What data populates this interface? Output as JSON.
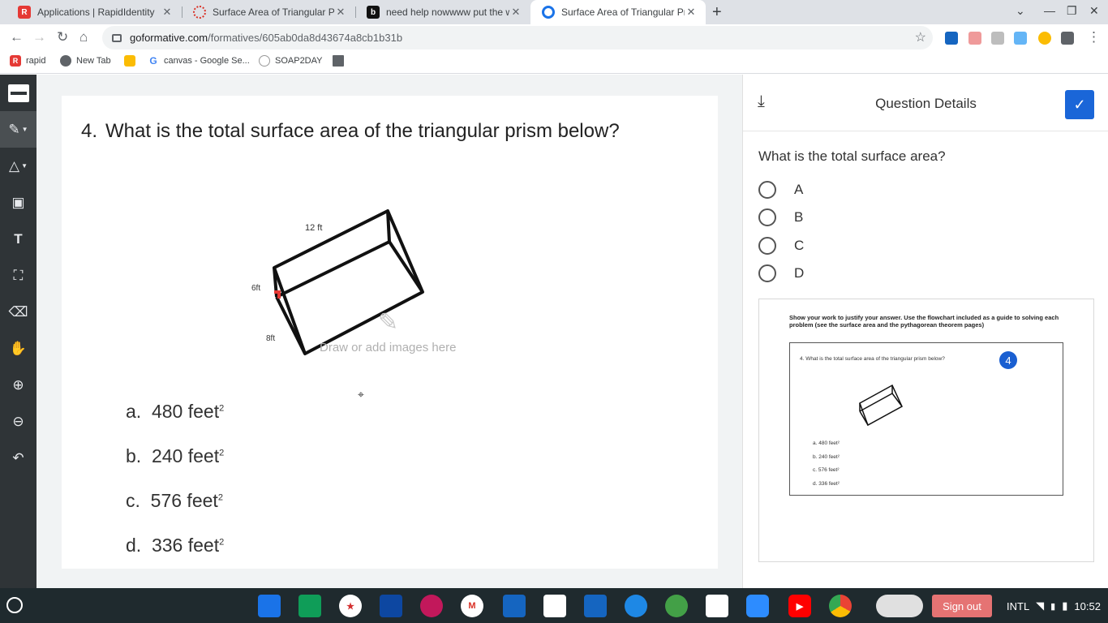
{
  "browser": {
    "tabs": [
      {
        "title": "Applications | RapidIdentity",
        "active": false
      },
      {
        "title": "Surface Area of Triangular Prism",
        "active": false
      },
      {
        "title": "need help nowwww put the work",
        "active": false
      },
      {
        "title": "Surface Area of Triangular Prism",
        "active": true
      }
    ],
    "url_host": "goformative.com",
    "url_path": "/formatives/605ab0da8d43674a8cb1b31b",
    "bookmarks": [
      "rapid",
      "New Tab",
      "canvas - Google Se...",
      "SOAP2DAY"
    ]
  },
  "tools": [
    "pen",
    "shapes",
    "image",
    "text",
    "expand",
    "eraser",
    "pan",
    "zoom-in",
    "zoom-out",
    "undo"
  ],
  "question": {
    "number": "4.",
    "text": "What is the total surface area of the triangular prism below?",
    "figure_labels": {
      "length": "12 ft",
      "height": "6ft",
      "base": "8ft"
    },
    "options": [
      {
        "letter": "a.",
        "value": "480 feet",
        "exp": "2"
      },
      {
        "letter": "b.",
        "value": "240 feet",
        "exp": "2"
      },
      {
        "letter": "c.",
        "value": "576 feet",
        "exp": "2"
      },
      {
        "letter": "d.",
        "value": "336 feet",
        "exp": "2"
      }
    ],
    "draw_hint": "Draw or add images here"
  },
  "panel": {
    "title": "Question Details",
    "prompt": "What is the total surface area?",
    "choices": [
      "A",
      "B",
      "C",
      "D"
    ],
    "preview_instructions": "Show your work to justify your answer.  Use the flowchart included as a guide to solving each problem (see the surface area and the pythagorean theorem pages)",
    "preview_question": "4.  What is the total surface area of the triangular prism below?",
    "preview_badge": "4",
    "preview_options": [
      "a.  480 feet²",
      "b.  240 feet²",
      "c.  576 feet²",
      "d.  336 feet²"
    ]
  },
  "shelf": {
    "signout": "Sign out",
    "locale": "INTL",
    "time": "10:52"
  },
  "colors": {
    "accent": "#1a66d8",
    "rail": "#2f3437",
    "shelf": "#1f2a2e",
    "signout": "#e57373"
  }
}
